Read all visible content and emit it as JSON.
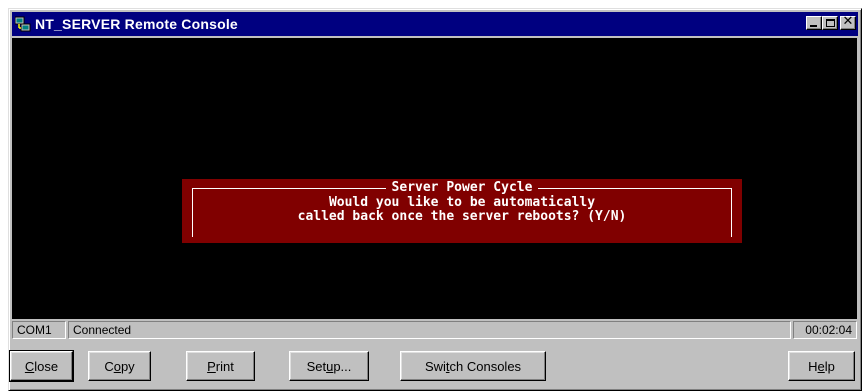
{
  "window": {
    "title": "NT_SERVER Remote Console"
  },
  "title_buttons": {
    "minimize_icon": "minimize-icon",
    "maximize_icon": "maximize-icon",
    "close_glyph": "✕"
  },
  "console": {
    "dialog": {
      "title": "Server Power Cycle",
      "line1": "Would you like to be automatically",
      "line2": "called back once the server reboots? (Y/N)"
    },
    "colors": {
      "background": "#000000",
      "dialog_background": "#800000",
      "text": "#ffffff"
    }
  },
  "statusbar": {
    "port": "COM1",
    "state": "Connected",
    "elapsed": "00:02:04"
  },
  "buttons": {
    "close": {
      "pre": "",
      "key": "C",
      "post": "lose"
    },
    "copy": {
      "pre": "C",
      "key": "o",
      "post": "py"
    },
    "print": {
      "pre": "",
      "key": "P",
      "post": "rint"
    },
    "setup": {
      "pre": "Set",
      "key": "u",
      "post": "p..."
    },
    "switch": {
      "pre": "Swi",
      "key": "t",
      "post": "ch Consoles"
    },
    "help": {
      "pre": "H",
      "key": "e",
      "post": "lp"
    }
  },
  "accent": {
    "titlebar": "#000080",
    "face": "#c0c0c0"
  }
}
